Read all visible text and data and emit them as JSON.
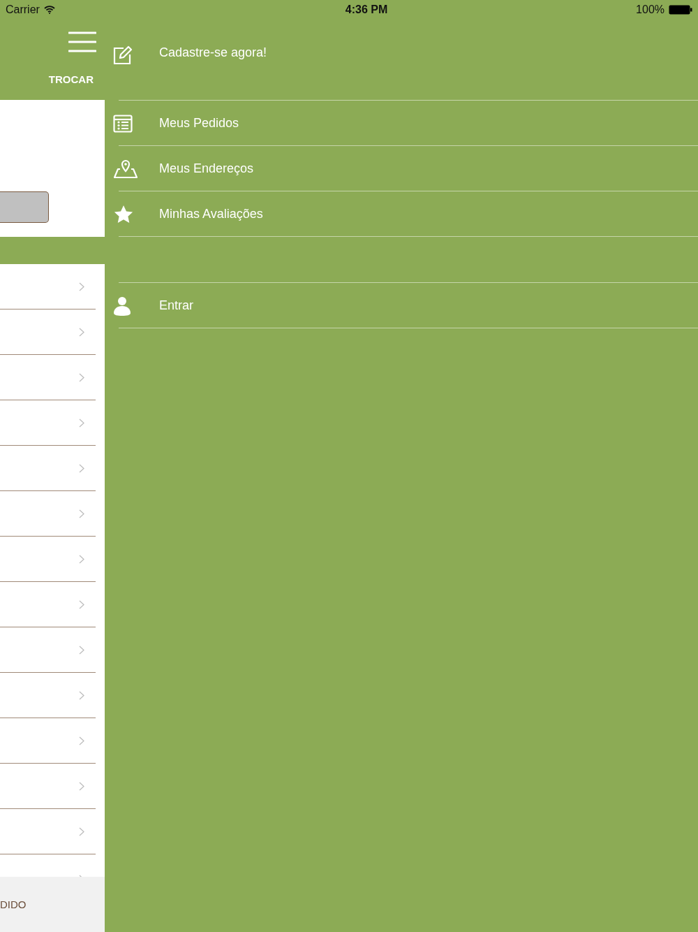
{
  "status_bar": {
    "carrier": "Carrier",
    "time": "4:36 PM",
    "battery": "100%"
  },
  "left_panel": {
    "switch_label": "TROCAR",
    "rows": [
      {
        "kind": "full"
      },
      {
        "kind": "full"
      },
      {
        "kind": "full"
      },
      {
        "kind": "full"
      },
      {
        "kind": "full"
      },
      {
        "kind": "full"
      },
      {
        "kind": "full"
      },
      {
        "kind": "full"
      },
      {
        "kind": "full"
      },
      {
        "kind": "full"
      },
      {
        "kind": "full"
      },
      {
        "kind": "full"
      },
      {
        "kind": "full"
      },
      {
        "kind": "partial"
      }
    ],
    "footer_label": "DIDO"
  },
  "menu": [
    {
      "kind": "signup",
      "label": "Cadastre-se agora!"
    },
    {
      "kind": "orders",
      "label": "Meus Pedidos"
    },
    {
      "kind": "addresses",
      "label": "Meus Endereços"
    },
    {
      "kind": "reviews",
      "label": "Minhas Avaliações"
    },
    {
      "kind": "spacer"
    },
    {
      "kind": "login",
      "label": "Entrar"
    }
  ]
}
